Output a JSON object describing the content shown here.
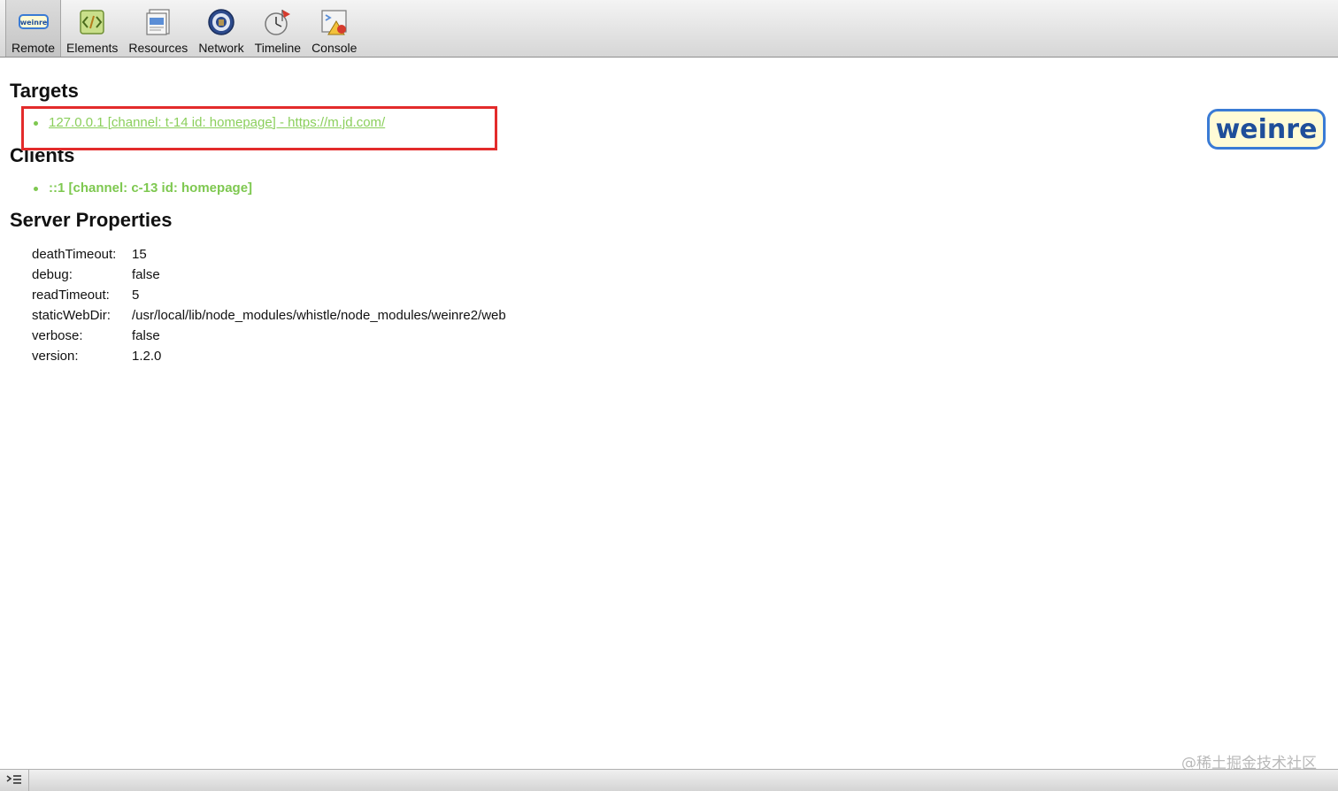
{
  "toolbar": {
    "tabs": [
      {
        "label": "Remote",
        "icon": "weinre-remote-icon"
      },
      {
        "label": "Elements",
        "icon": "elements-icon"
      },
      {
        "label": "Resources",
        "icon": "resources-icon"
      },
      {
        "label": "Network",
        "icon": "network-icon"
      },
      {
        "label": "Timeline",
        "icon": "timeline-icon"
      },
      {
        "label": "Console",
        "icon": "console-icon"
      }
    ],
    "active_tab": "Remote",
    "remote_icon_text": "weinre"
  },
  "targets": {
    "heading": "Targets",
    "items": [
      {
        "text": "127.0.0.1 [channel: t-14 id: homepage] - https://m.jd.com/"
      }
    ]
  },
  "clients": {
    "heading": "Clients",
    "items": [
      {
        "text": "::1 [channel: c-13 id: homepage]"
      }
    ]
  },
  "server_properties": {
    "heading": "Server Properties",
    "rows": [
      {
        "key": "deathTimeout:",
        "value": "15"
      },
      {
        "key": "debug:",
        "value": "false"
      },
      {
        "key": "readTimeout:",
        "value": "5"
      },
      {
        "key": "staticWebDir:",
        "value": "/usr/local/lib/node_modules/whistle/node_modules/weinre2/web"
      },
      {
        "key": "verbose:",
        "value": "false"
      },
      {
        "key": "version:",
        "value": "1.2.0"
      }
    ]
  },
  "logo": {
    "text": "weinre"
  },
  "watermark": {
    "text": "@稀土掘金技术社区"
  },
  "colors": {
    "link_green": "#8bcf5c",
    "highlight_red": "#e32b2b",
    "logo_blue": "#3a7bd5"
  }
}
